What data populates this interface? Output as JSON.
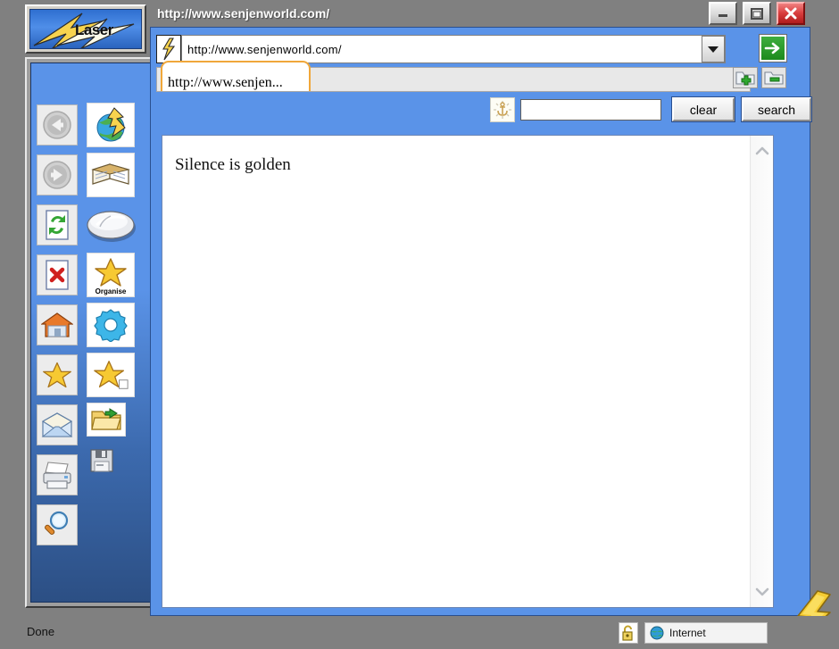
{
  "app": {
    "brand": "Laser",
    "window_title": "http://www.senjenworld.com/"
  },
  "titlebar": {
    "title": "http://www.senjenworld.com/",
    "minimize_label": "Minimize",
    "maximize_label": "Maximize",
    "close_label": "Close"
  },
  "toolbar": {
    "url_value": "http://www.senjenworld.com/",
    "url_placeholder": "http://",
    "go_label": "Go",
    "dropdown_label": "History",
    "add_tab_label": "New tab",
    "remove_tab_label": "Close tab"
  },
  "tabs": [
    {
      "label": "http://www.senjen...",
      "active": true
    }
  ],
  "search": {
    "value": "",
    "placeholder": "",
    "clear_label": "clear",
    "search_label": "search",
    "icon": "anchor-icon"
  },
  "sidebar": {
    "items": [
      {
        "name": "back",
        "label": "Back",
        "icon": "back-arrow-icon"
      },
      {
        "name": "globe",
        "label": "Web",
        "icon": "globe-bolt-icon"
      },
      {
        "name": "forward",
        "label": "Forward",
        "icon": "forward-arrow-icon"
      },
      {
        "name": "book",
        "label": "Read",
        "icon": "open-book-icon"
      },
      {
        "name": "reload",
        "label": "Reload",
        "icon": "refresh-page-icon"
      },
      {
        "name": "mouse",
        "label": "Pointer",
        "icon": "mouse-icon"
      },
      {
        "name": "stop",
        "label": "Stop",
        "icon": "stop-page-icon"
      },
      {
        "name": "organise",
        "label": "Organise",
        "icon": "star-organise-icon"
      },
      {
        "name": "home",
        "label": "Home",
        "icon": "house-icon"
      },
      {
        "name": "settings",
        "label": "Settings",
        "icon": "gear-icon"
      },
      {
        "name": "favourite",
        "label": "Favourite",
        "icon": "star-icon"
      },
      {
        "name": "add-favourite",
        "label": "Add favourite",
        "icon": "star-plus-icon"
      },
      {
        "name": "mail",
        "label": "Mail",
        "icon": "envelope-icon"
      },
      {
        "name": "open-folder",
        "label": "Open",
        "icon": "open-folder-icon"
      },
      {
        "name": "print",
        "label": "Print",
        "icon": "printer-icon"
      },
      {
        "name": "save",
        "label": "Save",
        "icon": "floppy-disk-icon"
      },
      {
        "name": "find",
        "label": "Find",
        "icon": "magnifier-icon"
      }
    ]
  },
  "content": {
    "body_text": "Silence is golden",
    "scroll_up_label": "Scroll up",
    "scroll_down_label": "Scroll down"
  },
  "statusbar": {
    "status": "Done",
    "security_icon": "open-padlock-icon",
    "zone_icon": "globe-icon",
    "zone": "Internet"
  },
  "colors": {
    "chrome_blue": "#5a93e8",
    "desktop_gray": "#808080",
    "tab_accent": "#f0a73a",
    "go_green": "#1d8a1d",
    "close_red": "#d83c3c",
    "bolt_yellow": "#f5cc33"
  }
}
